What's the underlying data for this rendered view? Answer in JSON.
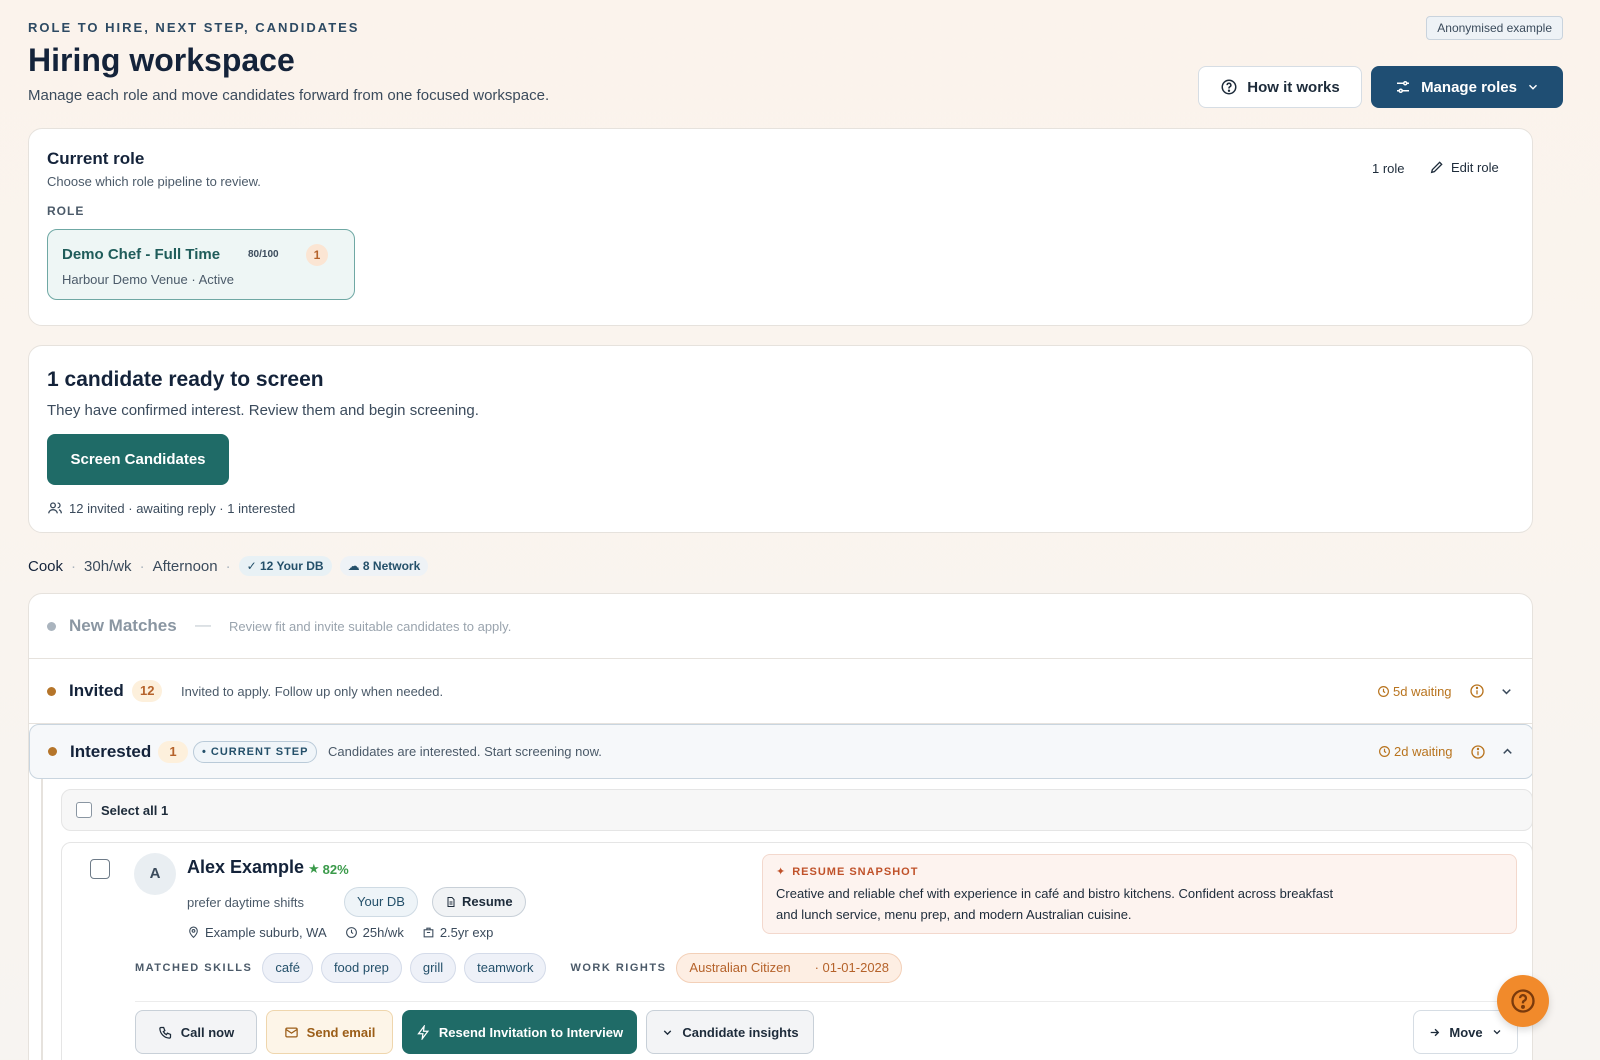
{
  "header": {
    "eyebrow": "ROLE TO HIRE, NEXT STEP, CANDIDATES",
    "title": "Hiring workspace",
    "subtitle": "Manage each role and move candidates forward from one focused workspace.",
    "badge": "Anonymised example",
    "how_it_works": "How it works",
    "manage_roles": "Manage roles"
  },
  "current_role": {
    "heading": "Current role",
    "description": "Choose which role pipeline to review.",
    "role_label": "ROLE",
    "role_count": "1 role",
    "edit_role": "Edit role",
    "role": {
      "title": "Demo Chef - Full Time",
      "score": "80/100",
      "count": "1",
      "venue": "Harbour Demo Venue · Active"
    }
  },
  "screen": {
    "heading": "1 candidate ready to screen",
    "description": "They have confirmed interest. Review them and begin screening.",
    "button": "Screen Candidates",
    "stats": "12 invited · awaiting reply · 1 interested"
  },
  "meta": {
    "job": "Cook",
    "hours": "30h/wk",
    "shift": "Afternoon",
    "your_db": "✓ 12 Your DB",
    "network": "8 Network"
  },
  "stages": {
    "new_matches": {
      "name": "New Matches",
      "desc": "Review fit and invite suitable candidates to apply."
    },
    "invited": {
      "name": "Invited",
      "count": "12",
      "desc": "Invited to apply. Follow up only when needed.",
      "wait": "5d waiting"
    },
    "interested": {
      "name": "Interested",
      "count": "1",
      "current": "• CURRENT STEP",
      "desc": "Candidates are interested. Start screening now.",
      "wait": "2d waiting"
    }
  },
  "select_all": "Select all 1",
  "candidate": {
    "initial": "A",
    "name": "Alex Example",
    "score": "82%",
    "note": "prefer daytime shifts",
    "source": "Your DB",
    "resume": "Resume",
    "location": "Example suburb, WA",
    "hours": "25h/wk",
    "experience": "2.5yr exp",
    "snapshot_label": "RESUME SNAPSHOT",
    "snapshot_text": "Creative and reliable chef with experience in café and bistro kitchens. Confident across breakfast and lunch service, menu prep, and modern Australian cuisine.",
    "skills_label": "MATCHED SKILLS",
    "skills": [
      "café",
      "food prep",
      "grill",
      "teamwork"
    ],
    "work_rights_label": "WORK RIGHTS",
    "work_rights": "Australian Citizen",
    "work_rights_date": "· 01-01-2028",
    "actions": {
      "call": "Call now",
      "email": "Send email",
      "resend": "Resend Invitation to Interview",
      "insights": "Candidate insights",
      "move": "Move"
    }
  },
  "colors": {
    "primary": "#1f4e73",
    "teal": "#1f6b67",
    "accent": "#f18a2b",
    "stage_dot": "#b5752a"
  }
}
